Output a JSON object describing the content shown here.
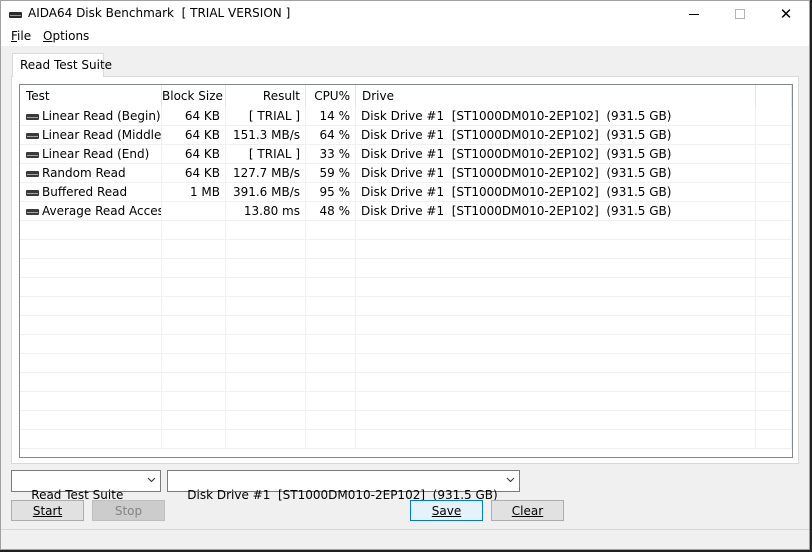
{
  "window": {
    "title": "AIDA64 Disk Benchmark  [ TRIAL VERSION ]",
    "minimize_symbol": "",
    "close_symbol": "✕"
  },
  "menu": {
    "file": "File",
    "options": "Options"
  },
  "tab": {
    "label": "Read Test Suite"
  },
  "table": {
    "headers": {
      "test": "Test",
      "block_size": "Block Size",
      "result": "Result",
      "cpu": "CPU%",
      "drive": "Drive"
    },
    "rows": [
      {
        "test": "Linear Read (Begin)",
        "block_size": "64 KB",
        "result": "[ TRIAL ]",
        "cpu": "14 %",
        "drive": "Disk Drive #1  [ST1000DM010-2EP102]  (931.5 GB)"
      },
      {
        "test": "Linear Read (Middle)",
        "block_size": "64 KB",
        "result": "151.3 MB/s",
        "cpu": "64 %",
        "drive": "Disk Drive #1  [ST1000DM010-2EP102]  (931.5 GB)"
      },
      {
        "test": "Linear Read (End)",
        "block_size": "64 KB",
        "result": "[ TRIAL ]",
        "cpu": "33 %",
        "drive": "Disk Drive #1  [ST1000DM010-2EP102]  (931.5 GB)"
      },
      {
        "test": "Random Read",
        "block_size": "64 KB",
        "result": "127.7 MB/s",
        "cpu": "59 %",
        "drive": "Disk Drive #1  [ST1000DM010-2EP102]  (931.5 GB)"
      },
      {
        "test": "Buffered Read",
        "block_size": "1 MB",
        "result": "391.6 MB/s",
        "cpu": "95 %",
        "drive": "Disk Drive #1  [ST1000DM010-2EP102]  (931.5 GB)"
      },
      {
        "test": "Average Read Access",
        "block_size": "",
        "result": "13.80 ms",
        "cpu": "48 %",
        "drive": "Disk Drive #1  [ST1000DM010-2EP102]  (931.5 GB)"
      }
    ]
  },
  "controls": {
    "suite_select": "Read Test Suite",
    "drive_select": "Disk Drive #1  [ST1000DM010-2EP102]  (931.5 GB)",
    "start": "Start",
    "stop": "Stop",
    "save": "Save",
    "clear": "Clear"
  },
  "icons": {
    "app": "disk-drive-icon",
    "row": "disk-drive-icon",
    "dropdown": "chevron-down-icon"
  },
  "colors": {
    "accent_border": "#0078d7",
    "button_face": "#e1e1e1",
    "list_border": "#828790"
  }
}
